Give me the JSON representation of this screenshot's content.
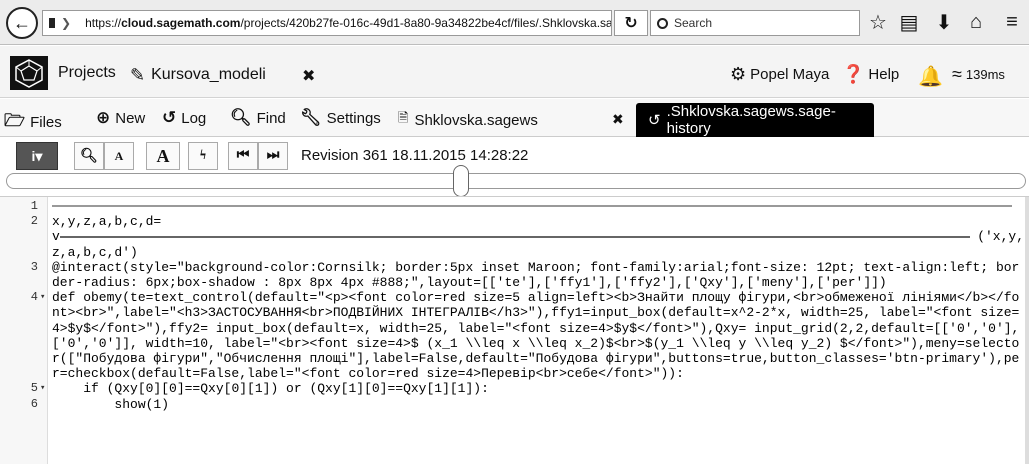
{
  "browser": {
    "url": "https://cloud.sagemath.com/projects/420b27fe-016c-49d1-8a80-9a34822be4cf/files/.Shklovska.sæ",
    "url_host": "cloud.sagemath.com",
    "url_prefix": "https://",
    "url_path": "/projects/420b27fe-016c-49d1-8a80-9a34822be4cf/files/.Shklovska.sæ",
    "search_placeholder": "Search"
  },
  "header": {
    "projects_label": "Projects",
    "project_tab": "Kursova_modeli",
    "user_label": "Popel Maya",
    "help_label": "Help",
    "ping": "139ms"
  },
  "nav": {
    "files": "Files",
    "new": "New",
    "log": "Log",
    "find": "Find",
    "settings": "Settings",
    "file_tab": "Shklovska.sagews",
    "history_tab": ".Shklovska.sagews.sage-history"
  },
  "toolbar": {
    "info": "i▾",
    "font_small": "A",
    "font_large": "A",
    "revision": "Revision 361 18.11.2015 14:28:22"
  },
  "code": {
    "lines": [
      {
        "n": "1",
        "fold": "",
        "text": ""
      },
      {
        "n": "2",
        "fold": "",
        "text": "x,y,z,a,b,c,d="
      },
      {
        "n": "",
        "fold": "",
        "text": "v"
      },
      {
        "n": "",
        "fold": "",
        "text": "z,a,b,c,d')"
      },
      {
        "n": "3",
        "fold": "",
        "text": "@interact(style=\"background-color:Cornsilk; border:5px inset Maroon; font-family:arial;font-size: 12pt; text-align:left; border-radius: 6px;box-shadow : 8px 8px 4px #888;\",layout=[['te'],['ffy1'],['ffy2'],['Qxy'],['meny'],['per']])"
      },
      {
        "n": "4",
        "fold": "▾",
        "text": "def obemy(te=text_control(default=\"<p><font color=red size=5 align=left><b>Знайти площу фігури,<br>обмеженої лініями</b></font><br>\",label=\"<h3>ЗАСТОСУВАННЯ<br>ПОДВІЙНИХ ІНТЕГРАЛІВ</h3>\"),ffy1=input_box(default=x^2-2*x, width=25, label=\"<font size=4>$y$</font>\"),ffy2= input_box(default=x, width=25, label=\"<font size=4>$y$</font>\"),Qxy= input_grid(2,2,default=[['0','0'],['0','0']], width=10, label=\"<br><font size=4>$ (x_1 \\\\leq x \\\\leq x_2)$<br>$(y_1 \\\\leq y \\\\leq y_2) $</font>\"),meny=selector([\"Побудова фігури\",\"Обчислення площі\"],label=False,default=\"Побудова фігури\",buttons=true,button_classes='btn-primary'),per=checkbox(default=False,label=\"<font color=red size=4>Перевір<br>себе</font>\")):"
      },
      {
        "n": "5",
        "fold": "▾",
        "text": "    if (Qxy[0][0]==Qxy[0][1]) or (Qxy[1][0]==Qxy[1][1]):"
      },
      {
        "n": "6",
        "fold": "",
        "text": "        show(1)"
      }
    ],
    "rule_tail": "('x,y,"
  },
  "colors": {
    "active_tab_bg": "#000000",
    "toolbar_dark": "#555555"
  }
}
